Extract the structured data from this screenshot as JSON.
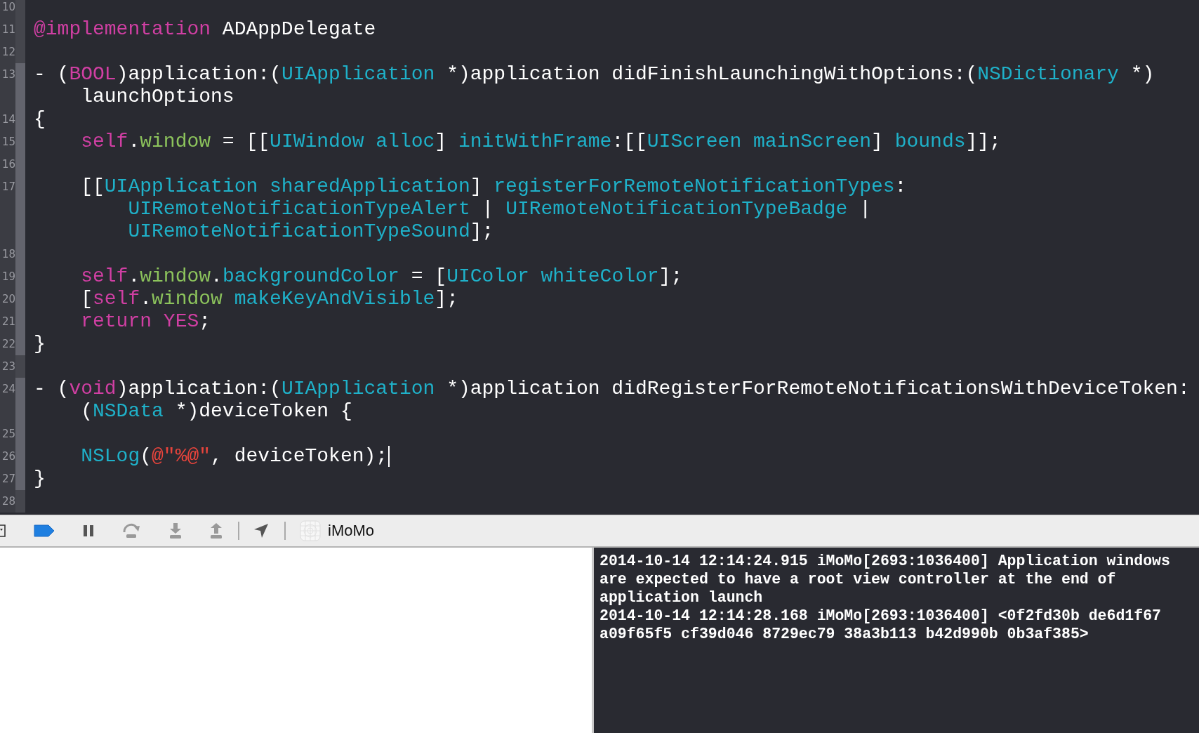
{
  "editor": {
    "lines": [
      {
        "number": "10",
        "changed": false,
        "caret": false
      },
      {
        "number": "11",
        "changed": false,
        "caret": false,
        "rows": [
          {
            "tokens": [
              {
                "text": "@implementation",
                "kind": "keyword"
              },
              {
                "text": " ADAppDelegate",
                "kind": "plain"
              }
            ]
          }
        ]
      },
      {
        "number": "12",
        "changed": false,
        "caret": false
      },
      {
        "number": "13",
        "changed": true,
        "caret": false,
        "rows": [
          {
            "tokens": [
              {
                "text": "- (",
                "kind": "plain"
              },
              {
                "text": "BOOL",
                "kind": "keyword"
              },
              {
                "text": ")application:(",
                "kind": "plain"
              },
              {
                "text": "UIApplication",
                "kind": "type"
              },
              {
                "text": " *)application didFinishLaunchingWithOptions:(",
                "kind": "plain"
              },
              {
                "text": "NSDictionary",
                "kind": "type"
              },
              {
                "text": " *)",
                "kind": "plain"
              }
            ]
          },
          {
            "tokens": [
              {
                "text": "    launchOptions",
                "kind": "plain"
              }
            ]
          }
        ]
      },
      {
        "number": "14",
        "changed": true,
        "caret": false,
        "rows": [
          {
            "tokens": [
              {
                "text": "{",
                "kind": "plain"
              }
            ]
          }
        ]
      },
      {
        "number": "15",
        "changed": true,
        "caret": false,
        "rows": [
          {
            "tokens": [
              {
                "text": "    self",
                "kind": "keyword"
              },
              {
                "text": ".",
                "kind": "plain"
              },
              {
                "text": "window",
                "kind": "property"
              },
              {
                "text": " = [[",
                "kind": "plain"
              },
              {
                "text": "UIWindow alloc",
                "kind": "type"
              },
              {
                "text": "] ",
                "kind": "plain"
              },
              {
                "text": "initWithFrame",
                "kind": "type"
              },
              {
                "text": ":[[",
                "kind": "plain"
              },
              {
                "text": "UIScreen mainScreen",
                "kind": "type"
              },
              {
                "text": "] ",
                "kind": "plain"
              },
              {
                "text": "bounds",
                "kind": "type"
              },
              {
                "text": "]];",
                "kind": "plain"
              }
            ]
          }
        ]
      },
      {
        "number": "16",
        "changed": true,
        "caret": false
      },
      {
        "number": "17",
        "changed": true,
        "caret": false,
        "rows": [
          {
            "tokens": [
              {
                "text": "    [[",
                "kind": "plain"
              },
              {
                "text": "UIApplication sharedApplication",
                "kind": "type"
              },
              {
                "text": "] ",
                "kind": "plain"
              },
              {
                "text": "registerForRemoteNotificationTypes",
                "kind": "type"
              },
              {
                "text": ":",
                "kind": "plain"
              }
            ]
          },
          {
            "tokens": [
              {
                "text": "        UIRemoteNotificationTypeAlert",
                "kind": "type"
              },
              {
                "text": " | ",
                "kind": "plain"
              },
              {
                "text": "UIRemoteNotificationTypeBadge",
                "kind": "type"
              },
              {
                "text": " |",
                "kind": "plain"
              }
            ]
          },
          {
            "tokens": [
              {
                "text": "        UIRemoteNotificationTypeSound",
                "kind": "type"
              },
              {
                "text": "];",
                "kind": "plain"
              }
            ]
          }
        ]
      },
      {
        "number": "18",
        "changed": true,
        "caret": false
      },
      {
        "number": "19",
        "changed": true,
        "caret": false,
        "rows": [
          {
            "tokens": [
              {
                "text": "    self",
                "kind": "keyword"
              },
              {
                "text": ".",
                "kind": "plain"
              },
              {
                "text": "window",
                "kind": "property"
              },
              {
                "text": ".",
                "kind": "plain"
              },
              {
                "text": "backgroundColor",
                "kind": "type"
              },
              {
                "text": " = [",
                "kind": "plain"
              },
              {
                "text": "UIColor whiteColor",
                "kind": "type"
              },
              {
                "text": "];",
                "kind": "plain"
              }
            ]
          }
        ]
      },
      {
        "number": "20",
        "changed": true,
        "caret": false,
        "rows": [
          {
            "tokens": [
              {
                "text": "    [",
                "kind": "plain"
              },
              {
                "text": "self",
                "kind": "keyword"
              },
              {
                "text": ".",
                "kind": "plain"
              },
              {
                "text": "window",
                "kind": "property"
              },
              {
                "text": " makeKeyAndVisible",
                "kind": "type"
              },
              {
                "text": "];",
                "kind": "plain"
              }
            ]
          }
        ]
      },
      {
        "number": "21",
        "changed": true,
        "caret": false,
        "rows": [
          {
            "tokens": [
              {
                "text": "    return YES",
                "kind": "keyword"
              },
              {
                "text": ";",
                "kind": "plain"
              }
            ]
          }
        ]
      },
      {
        "number": "22",
        "changed": true,
        "caret": false,
        "rows": [
          {
            "tokens": [
              {
                "text": "}",
                "kind": "plain"
              }
            ]
          }
        ]
      },
      {
        "number": "23",
        "changed": false,
        "caret": false
      },
      {
        "number": "24",
        "changed": true,
        "caret": false,
        "rows": [
          {
            "tokens": [
              {
                "text": "- (",
                "kind": "plain"
              },
              {
                "text": "void",
                "kind": "keyword"
              },
              {
                "text": ")application:(",
                "kind": "plain"
              },
              {
                "text": "UIApplication",
                "kind": "type"
              },
              {
                "text": " *)application didRegisterForRemoteNotificationsWithDeviceToken:",
                "kind": "plain"
              }
            ]
          },
          {
            "tokens": [
              {
                "text": "    (",
                "kind": "plain"
              },
              {
                "text": "NSData",
                "kind": "type"
              },
              {
                "text": " *)deviceToken {",
                "kind": "plain"
              }
            ]
          }
        ]
      },
      {
        "number": "25",
        "changed": true,
        "caret": false
      },
      {
        "number": "26",
        "changed": true,
        "caret": true,
        "rows": [
          {
            "tokens": [
              {
                "text": "    NSLog",
                "kind": "type"
              },
              {
                "text": "(",
                "kind": "plain"
              },
              {
                "text": "@\"%@\"",
                "kind": "string"
              },
              {
                "text": ", deviceToken);",
                "kind": "plain"
              }
            ]
          }
        ]
      },
      {
        "number": "27",
        "changed": true,
        "caret": false,
        "rows": [
          {
            "tokens": [
              {
                "text": "}",
                "kind": "plain"
              }
            ]
          }
        ]
      },
      {
        "number": "28",
        "changed": false,
        "caret": false
      }
    ]
  },
  "debug_bar": {
    "breakpoints_active": true,
    "process": "iMoMo"
  },
  "console": {
    "messages": [
      "2014-10-14 12:14:24.915 iMoMo[2693:1036400] Application windows are expected to have a root view controller at the end of application launch",
      "2014-10-14 12:14:28.168 iMoMo[2693:1036400] <0f2fd30b de6d1f67 a09f65f5 cf39d046 8729ec79 38a3b113 b42d990b 0b3af385>"
    ]
  }
}
